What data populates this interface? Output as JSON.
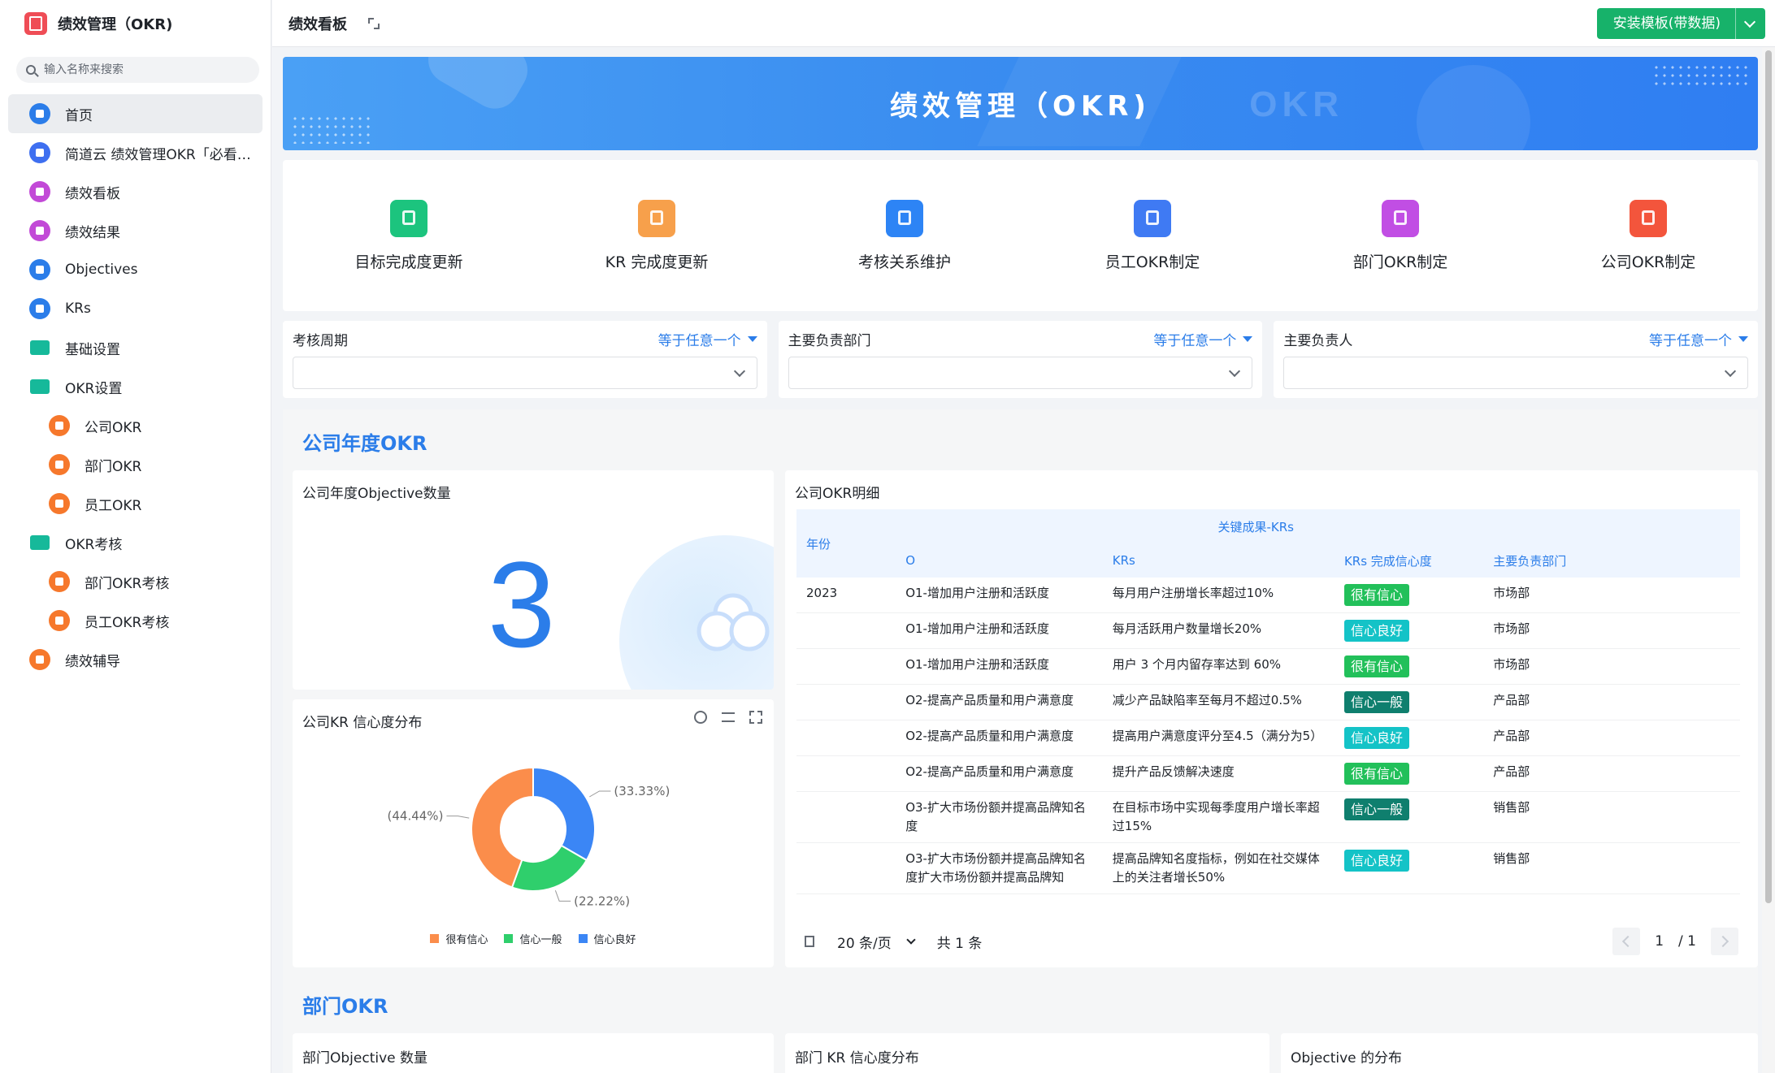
{
  "app": {
    "title": "绩效管理（OKR)",
    "logo_color": "#ef4d56"
  },
  "search": {
    "placeholder": "输入名称来搜索"
  },
  "sidebar": {
    "items": [
      {
        "label": "首页",
        "icon": "home-icon",
        "color": "#2b7de9",
        "active": true,
        "sub": false
      },
      {
        "label": "简道云 绩效管理OKR「必看说...",
        "icon": "document-icon",
        "color": "#3e6ff0",
        "sub": false
      },
      {
        "label": "绩效看板",
        "icon": "dashboard-icon",
        "color": "#c249d7",
        "sub": false
      },
      {
        "label": "绩效结果",
        "icon": "dashboard-icon",
        "color": "#c249d7",
        "sub": false
      },
      {
        "label": "Objectives",
        "icon": "target-icon",
        "color": "#2b7de9",
        "sub": false
      },
      {
        "label": "KRs",
        "icon": "bookmark-icon",
        "color": "#2b7de9",
        "sub": false
      },
      {
        "label": "基础设置",
        "icon": "folder-icon",
        "color": "#16b99a",
        "sub": false
      },
      {
        "label": "OKR设置",
        "icon": "folder-icon",
        "color": "#16b99a",
        "sub": false
      },
      {
        "label": "公司OKR",
        "icon": "form-icon",
        "color": "#f6782c",
        "sub": true
      },
      {
        "label": "部门OKR",
        "icon": "box-icon",
        "color": "#f6782c",
        "sub": true
      },
      {
        "label": "员工OKR",
        "icon": "tag-icon",
        "color": "#f6782c",
        "sub": true
      },
      {
        "label": "OKR考核",
        "icon": "folder-icon",
        "color": "#16b99a",
        "sub": false
      },
      {
        "label": "部门OKR考核",
        "icon": "form-icon",
        "color": "#f6782c",
        "sub": true
      },
      {
        "label": "员工OKR考核",
        "icon": "form-icon",
        "color": "#f6782c",
        "sub": true
      },
      {
        "label": "绩效辅导",
        "icon": "chart-icon",
        "color": "#f6782c",
        "sub": false
      }
    ]
  },
  "topbar": {
    "tab": "绩效看板",
    "install_label": "安装模板(带数据)"
  },
  "banner": {
    "title": "绩效管理（OKR)",
    "ghost": "OKR"
  },
  "shortcuts": [
    {
      "label": "目标完成度更新",
      "icon": "flag-icon",
      "color": "#1cc47e"
    },
    {
      "label": "KR 完成度更新",
      "icon": "envelope-icon",
      "color": "#f7a04b"
    },
    {
      "label": "考核关系维护",
      "icon": "download-icon",
      "color": "#2d84f5"
    },
    {
      "label": "员工OKR制定",
      "icon": "document-icon",
      "color": "#3f7af3"
    },
    {
      "label": "部门OKR制定",
      "icon": "chart-icon",
      "color": "#c14ee4"
    },
    {
      "label": "公司OKR制定",
      "icon": "star-icon",
      "color": "#f3553c"
    }
  ],
  "filters": [
    {
      "label": "考核周期",
      "op": "等于任意一个"
    },
    {
      "label": "主要负责部门",
      "op": "等于任意一个"
    },
    {
      "label": "主要负责人",
      "op": "等于任意一个"
    }
  ],
  "company_section": {
    "title": "公司年度OKR",
    "objective_count": {
      "title": "公司年度Objective数量",
      "value": "3"
    },
    "kr_confidence": {
      "title": "公司KR 信心度分布"
    },
    "detail": {
      "title": "公司OKR明细",
      "col_year": "年份",
      "group": "关键成果-KRs",
      "col_o": "O",
      "col_kr": "KRs",
      "col_conf": "KRs 完成信心度",
      "col_dept": "主要负责部门",
      "rows": [
        {
          "year": "2023",
          "o": "O1-增加用户注册和活跃度",
          "kr": "每月用户注册增长率超过10%",
          "conf": "很有信心",
          "dept": "市场部"
        },
        {
          "year": "",
          "o": "O1-增加用户注册和活跃度",
          "kr": "每月活跃用户数量增长20%",
          "conf": "信心良好",
          "dept": "市场部"
        },
        {
          "year": "",
          "o": "O1-增加用户注册和活跃度",
          "kr": "用户 3 个月内留存率达到 60%",
          "conf": "很有信心",
          "dept": "市场部"
        },
        {
          "year": "",
          "o": "O2-提高产品质量和用户满意度",
          "kr": "减少产品缺陷率至每月不超过0.5%",
          "conf": "信心一般",
          "dept": "产品部"
        },
        {
          "year": "",
          "o": "O2-提高产品质量和用户满意度",
          "kr": "提高用户满意度评分至4.5（满分为5）",
          "conf": "信心良好",
          "dept": "产品部"
        },
        {
          "year": "",
          "o": "O2-提高产品质量和用户满意度",
          "kr": "提升产品反馈解决速度",
          "conf": "很有信心",
          "dept": "产品部"
        },
        {
          "year": "",
          "o": "O3-扩大市场份额并提高品牌知名度",
          "kr": "在目标市场中实现每季度用户增长率超过15%",
          "conf": "信心一般",
          "dept": "销售部"
        },
        {
          "year": "",
          "o": "O3-扩大市场份额并提高品牌知名度扩大市场份额并提高品牌知",
          "kr": "提高品牌知名度指标，例如在社交媒体上的关注者增长50%",
          "conf": "信心良好",
          "dept": "销售部"
        }
      ],
      "tag_colors": {
        "很有信心": "#22c05a",
        "信心良好": "#14c3c7",
        "信心一般": "#0f7f6e"
      },
      "pager": {
        "size": "20 条/页",
        "total": "共 1 条",
        "page": "1",
        "pages": "/ 1"
      }
    }
  },
  "chart_data": {
    "type": "pie",
    "categories": [
      "很有信心",
      "信心一般",
      "信心良好"
    ],
    "values": [
      44.44,
      22.22,
      33.33
    ],
    "labels": [
      "(44.44%)",
      "(22.22%)",
      "(33.33%)"
    ],
    "colors": [
      "#fb8d4b",
      "#2fcf6c",
      "#3b86f5"
    ]
  },
  "dept_section": {
    "title": "部门OKR",
    "cards": [
      "部门Objective 数量",
      "部门 KR 信心度分布",
      "Objective 的分布"
    ]
  }
}
